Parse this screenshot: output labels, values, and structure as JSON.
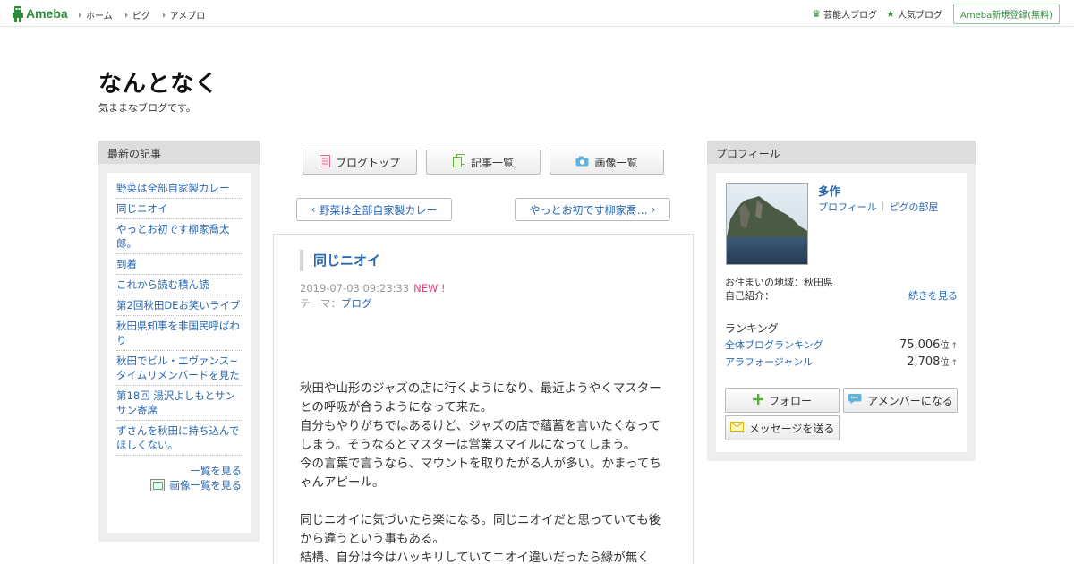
{
  "global_header": {
    "logo_text": "Ameba",
    "nav": [
      "ホーム",
      "ピグ",
      "アメブロ"
    ],
    "links": [
      {
        "label": "芸能人ブログ",
        "icon": "crown-icon"
      },
      {
        "label": "人気ブログ",
        "icon": "star-icon"
      }
    ],
    "register_label": "Ameba新規登録(無料)",
    "accent_color": "#2d8c3c"
  },
  "blog": {
    "title": "なんとなく",
    "description": "気ままなブログです。"
  },
  "left_sidebar": {
    "heading": "最新の記事",
    "items": [
      "野菜は全部自家製カレー",
      "同じニオイ",
      "やっとお初です柳家喬太郎。",
      "到着",
      "これから読む積ん読",
      "第2回秋田DEお笑いライブ",
      "秋田県知事を非国民呼ばわり",
      "秋田でビル・エヴァンス~タイムリメンバードを見た",
      "第18回 湯沢よしもとサンサン寄席",
      "ずさんを秋田に持ち込んでほしくない。"
    ],
    "see_all": "一覧を見る",
    "see_images": "画像一覧を見る"
  },
  "center": {
    "top_buttons": {
      "blog_top": "ブログトップ",
      "article_list": "記事一覧",
      "image_list": "画像一覧"
    },
    "prev_label": "野菜は全部自家製カレー",
    "next_label": "やっとお初です柳家喬…",
    "article": {
      "title": "同じニオイ",
      "datetime": "2019-07-03 09:23:33",
      "new_badge": "NEW !",
      "theme_prefix": "テーマ：",
      "theme": "ブログ",
      "body": [
        "秋田や山形のジャズの店に行くようになり、最近ようやくマスターとの呼吸が合うようになって来た。",
        "自分もやりがちではあるけど、ジャズの店で蘊蓄を言いたくなってしまう。そうなるとマスターは営業スマイルになってしまう。",
        "今の言葉で言うなら、マウントを取りたがる人が多い。かまってちゃんアピール。",
        "",
        "同じニオイに気づいたら楽になる。同じニオイだと思っていても後から違うという事もある。",
        "結構、自分は今はハッキリしていてニオイ違いだったら縁が無く"
      ]
    }
  },
  "right_sidebar": {
    "heading": "プロフィール",
    "name": "多作",
    "profile_link": "プロフィール",
    "pigg_link": "ピグの部屋",
    "region": "お住まいの地域：秋田県",
    "intro_label": "自己紹介：",
    "intro_more": "続きを見る",
    "ranking_heading": "ランキング",
    "rankings": [
      {
        "name": "全体ブログランキング",
        "value": "75,006",
        "unit": "位",
        "arrow": "↑"
      },
      {
        "name": "アラフォージャンル",
        "value": "2,708",
        "unit": "位",
        "arrow": "↑"
      }
    ],
    "buttons": {
      "follow": "フォロー",
      "amember": "アメンバーになる",
      "message": "メッセージを送る"
    }
  }
}
